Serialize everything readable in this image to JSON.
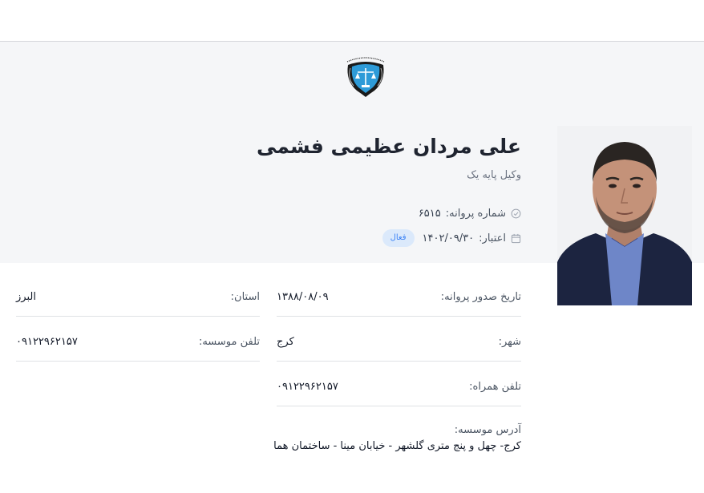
{
  "profile": {
    "name": "علی مردان عظیمی فشمی",
    "rank": "وکیل پایه یک",
    "license_label": "شماره پروانه:",
    "license_number": "۶۵۱۵",
    "validity_label": "اعتبار:",
    "validity_date": "۱۴۰۲/۰۹/۳۰",
    "status_badge": "فعال"
  },
  "details": {
    "issue_date_label": "تاریخ صدور پروانه:",
    "issue_date": "۱۳۸۸/۰۸/۰۹",
    "province_label": "استان:",
    "province": "البرز",
    "city_label": "شهر:",
    "city": "کرج",
    "office_phone_label": "تلفن موسسه:",
    "office_phone": "۰۹۱۲۲۹۶۲۱۵۷",
    "mobile_label": "تلفن همراه:",
    "mobile": "۰۹۱۲۲۹۶۲۱۵۷",
    "address_label": "آدرس موسسه:",
    "address": "کرج- چهل و پنج متری گلشهر - خیابان مینا - ساختمان هما"
  },
  "icons": {
    "license": "check-circle-icon",
    "validity": "calendar-icon",
    "emblem": "bar-association-emblem"
  },
  "colors": {
    "header_band": "#f5f6f8",
    "badge_bg": "#dbe9fb",
    "badge_text": "#3b82f6",
    "suit": "#1c2440"
  }
}
